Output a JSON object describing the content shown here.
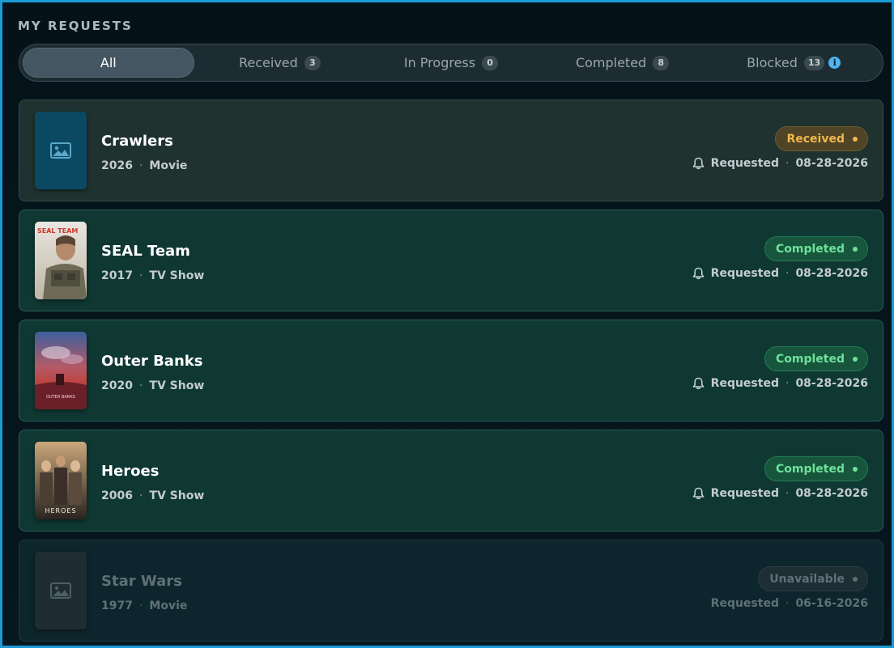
{
  "header": {
    "title": "MY REQUESTS"
  },
  "tabs": [
    {
      "label": "All",
      "count": null,
      "active": true
    },
    {
      "label": "Received",
      "count": "3",
      "active": false
    },
    {
      "label": "In Progress",
      "count": "0",
      "active": false
    },
    {
      "label": "Completed",
      "count": "8",
      "active": false
    },
    {
      "label": "Blocked",
      "count": "13",
      "active": false,
      "info_icon": "info-icon"
    }
  ],
  "requests": [
    {
      "title": "Crawlers",
      "year": "2026",
      "type": "Movie",
      "status": "Received",
      "requested_label": "Requested",
      "date": "08-28-2026",
      "poster": "placeholder-image-icon"
    },
    {
      "title": "SEAL Team",
      "year": "2017",
      "type": "TV Show",
      "status": "Completed",
      "requested_label": "Requested",
      "date": "08-28-2026",
      "poster": "seal-team-poster",
      "poster_text": "SEAL TEAM"
    },
    {
      "title": "Outer Banks",
      "year": "2020",
      "type": "TV Show",
      "status": "Completed",
      "requested_label": "Requested",
      "date": "08-28-2026",
      "poster": "outer-banks-poster",
      "poster_text": "OUTER BANKS"
    },
    {
      "title": "Heroes",
      "year": "2006",
      "type": "TV Show",
      "status": "Completed",
      "requested_label": "Requested",
      "date": "08-28-2026",
      "poster": "heroes-poster",
      "poster_text": "HEROES"
    },
    {
      "title": "Star Wars",
      "year": "1977",
      "type": "Movie",
      "status": "Unavailable",
      "requested_label": "Requested",
      "date": "06-16-2026",
      "poster": "placeholder-image-icon"
    }
  ],
  "colors": {
    "accent_border": "#1c9ad6",
    "received": "#f2b84b",
    "completed": "#6ee19b",
    "unavailable": "#5f7178",
    "info": "#4fb4f0"
  },
  "separator": "·"
}
